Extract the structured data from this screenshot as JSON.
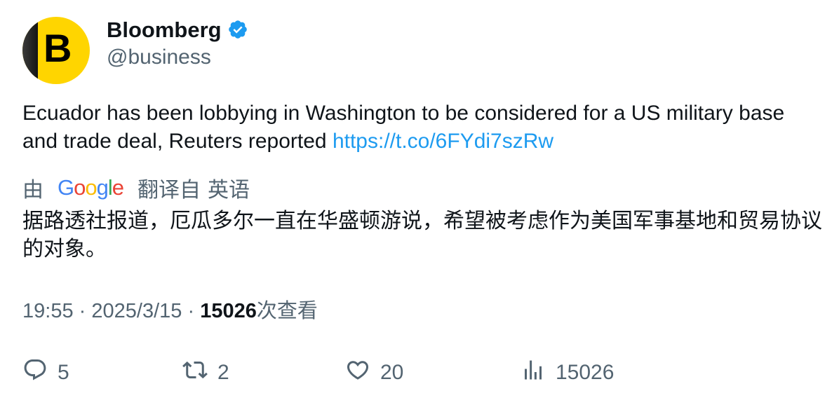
{
  "author": {
    "avatar_letter": "B",
    "name": "Bloomberg",
    "handle": "@business",
    "verified_color": "#1d9bf0"
  },
  "tweet": {
    "text": "Ecuador has been lobbying in Washington to be considered for a US military base and trade deal, Reuters reported ",
    "link": "https://t.co/6FYdi7szRw"
  },
  "translation": {
    "prefix": "由",
    "provider": "Google",
    "label_from": "翻译自",
    "language": "英语",
    "text": "据路透社报道，厄瓜多尔一直在华盛顿游说，希望被考虑作为美国军事基地和贸易协议的对象。"
  },
  "meta": {
    "time": "19:55",
    "separator": "·",
    "date": "2025/3/15",
    "views": "15026",
    "views_suffix": "次查看"
  },
  "actions": {
    "replies": "5",
    "retweets": "2",
    "likes": "20",
    "views": "15026"
  }
}
